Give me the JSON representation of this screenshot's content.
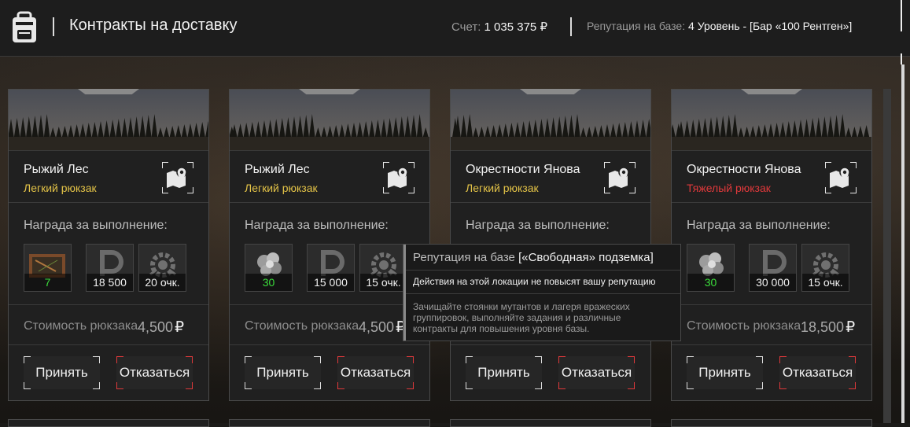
{
  "header": {
    "title": "Контракты на доставку",
    "balance_label": "Счет:",
    "balance_value": "1 035 375",
    "balance_currency": "₽",
    "reputation_label": "Репутация на базе:",
    "reputation_value": "4 Уровень - [Бар «100 Рентген»]"
  },
  "colors": {
    "light_backpack": "#e2c247",
    "heavy_backpack": "#e0393b",
    "green_value": "#3bdc3b"
  },
  "labels": {
    "reward": "Награда за выполнение:",
    "cost": "Стоимость рюкзака",
    "accept": "Принять",
    "decline": "Отказаться",
    "currency": "₽"
  },
  "cards": [
    {
      "location": "Рыжий Лес",
      "backpack": "Легкий рюкзак",
      "backpack_type": "light",
      "rewards": [
        {
          "icon": "map-item-icon",
          "value": "7",
          "green": true
        },
        {
          "icon": "money-icon",
          "value": "18 500",
          "green": false
        },
        {
          "icon": "reputation-gear-icon",
          "value": "20 очк.",
          "green": false
        }
      ],
      "cost": "4,500"
    },
    {
      "location": "Рыжий Лес",
      "backpack": "Легкий рюкзак",
      "backpack_type": "light",
      "rewards": [
        {
          "icon": "artifact-item-icon",
          "value": "30",
          "green": true
        },
        {
          "icon": "money-icon",
          "value": "15 000",
          "green": false
        },
        {
          "icon": "reputation-gear-icon",
          "value": "15 очк.",
          "green": false
        }
      ],
      "cost": "4,500"
    },
    {
      "location": "Окрестности Янова",
      "backpack": "Легкий рюкзак",
      "backpack_type": "light",
      "rewards": [],
      "cost": ""
    },
    {
      "location": "Окрестности Янова",
      "backpack": "Тяжелый рюкзак",
      "backpack_type": "heavy",
      "rewards": [
        {
          "icon": "artifact-item-icon",
          "value": "30",
          "green": true
        },
        {
          "icon": "money-icon",
          "value": "30 000",
          "green": false
        },
        {
          "icon": "reputation-gear-icon",
          "value": "15 очк.",
          "green": false
        }
      ],
      "cost": "18,500"
    }
  ],
  "tooltip": {
    "title": "Репутация на базе",
    "base": "[«Свободная» подземка]",
    "notice": "Действия на этой локации не повысят вашу репутацию",
    "description": "Зачищайте стоянки мутантов и лагеря вражеских группировок, выполняйте задания и различные контракты для повышения уровня базы."
  }
}
